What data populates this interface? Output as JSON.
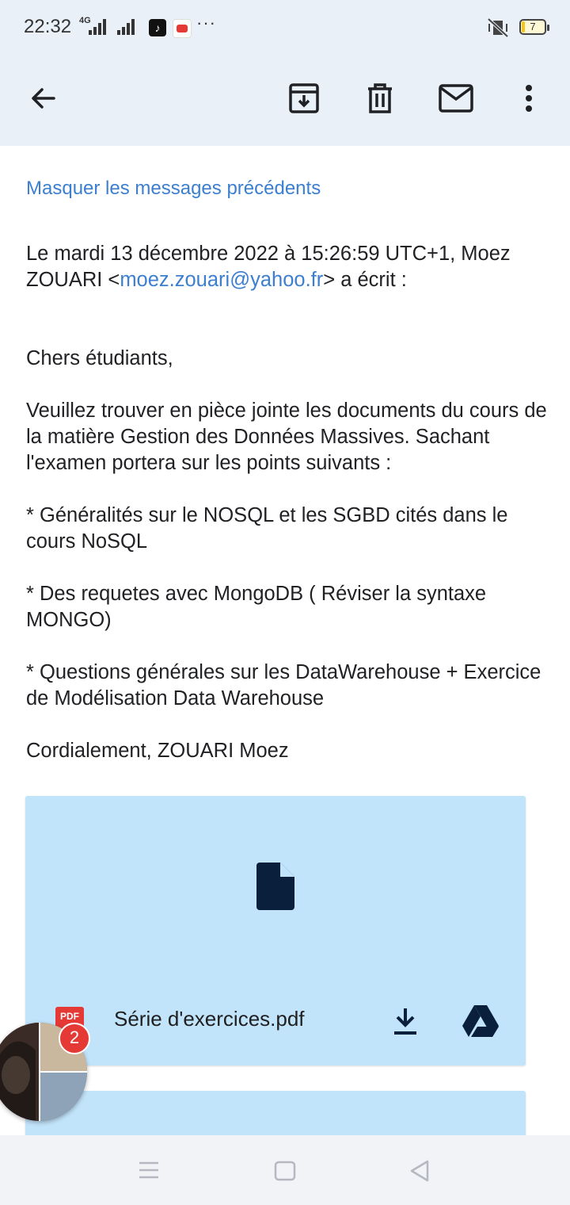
{
  "status_bar": {
    "time": "22:32",
    "network_label": "4G",
    "battery_level": "7",
    "icons": [
      "signal-icon",
      "signal-icon",
      "tiktok-icon",
      "youtube-icon",
      "more-icon",
      "vibrate-off-icon",
      "battery-icon"
    ]
  },
  "toolbar": {
    "icons": [
      "back-arrow-icon",
      "archive-icon",
      "delete-icon",
      "mark-unread-icon",
      "more-vert-icon"
    ]
  },
  "email": {
    "hide_previous_link": "Masquer les messages précédents",
    "quote_header_prefix": "Le mardi 13 décembre 2022 à 15:26:59 UTC+1, Moez ZOUARI <",
    "quote_header_email": "moez.zouari@yahoo.fr",
    "quote_header_suffix": "> a écrit :",
    "greeting": "Chers étudiants,",
    "paragraph1": "Veuillez trouver en pièce jointe les documents du cours de la matière Gestion des Données Massives. Sachant l'examen portera sur les points suivants :",
    "point1": "* Généralités sur le NOSQL et les SGBD cités dans le cours NoSQL",
    "point2": "* Des requetes avec MongoDB ( Réviser la syntaxe MONGO)",
    "point3": "* Questions générales sur les DataWarehouse + Exercice de Modélisation Data Warehouse",
    "signature": "Cordialement, ZOUARI Moez"
  },
  "attachment": {
    "file_name": "Série d'exercices.pdf",
    "type_label": "PDF",
    "icons": [
      "file-icon",
      "pdf-icon",
      "download-icon",
      "google-drive-icon"
    ]
  },
  "chat_bubble": {
    "badge_count": "2"
  },
  "nav_bar": {
    "icons": [
      "menu-icon",
      "home-icon",
      "back-icon"
    ]
  },
  "colors": {
    "accent": "#3c7fd0",
    "header_bg": "#e9f0f8",
    "attachment_bg": "#c2e4fb",
    "badge_red": "#e53935"
  }
}
